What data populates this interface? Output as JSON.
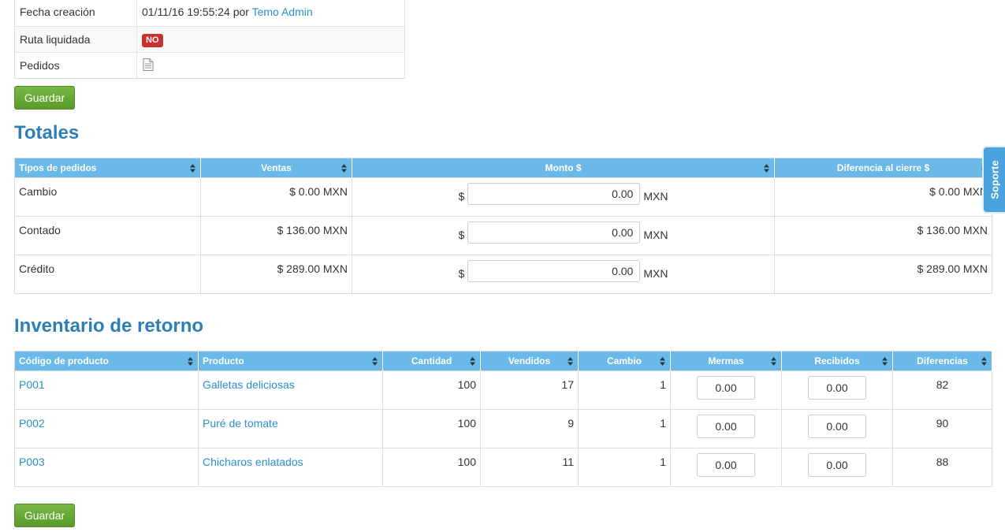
{
  "info": {
    "rows": [
      {
        "label": "Fecha creación",
        "date": "01/11/16 19:55:24",
        "by": "por",
        "user": "Temo Admin"
      },
      {
        "label": "Ruta liquidada",
        "badge": "NO"
      },
      {
        "label": "Pedidos",
        "icon": "document-icon"
      }
    ]
  },
  "buttons": {
    "save_label": "Guardar"
  },
  "totales": {
    "title": "Totales",
    "headers": [
      "Tipos de pedidos",
      "Ventas",
      "Monto $",
      "Diferencia al cierre $"
    ],
    "currency_prefix": "$",
    "currency_suffix": "MXN",
    "rows": [
      {
        "tipo": "Cambio",
        "ventas": "$ 0.00 MXN",
        "monto": "0.00",
        "diferencia": "$ 0.00 MXN"
      },
      {
        "tipo": "Contado",
        "ventas": "$ 136.00 MXN",
        "monto": "0.00",
        "diferencia": "$ 136.00 MXN"
      },
      {
        "tipo": "Crédito",
        "ventas": "$ 289.00 MXN",
        "monto": "0.00",
        "diferencia": "$ 289.00 MXN"
      }
    ]
  },
  "inventario": {
    "title": "Inventario de retorno",
    "headers": [
      "Código de producto",
      "Producto",
      "Cantidad",
      "Vendidos",
      "Cambio",
      "Mermas",
      "Recibidos",
      "Diferencias"
    ],
    "rows": [
      {
        "codigo": "P001",
        "producto": "Galletas deliciosas",
        "cantidad": "100",
        "vendidos": "17",
        "cambio": "1",
        "mermas": "0.00",
        "recibidos": "0.00",
        "diferencias": "82"
      },
      {
        "codigo": "P002",
        "producto": "Puré de tomate",
        "cantidad": "100",
        "vendidos": "9",
        "cambio": "1",
        "mermas": "0.00",
        "recibidos": "0.00",
        "diferencias": "90"
      },
      {
        "codigo": "P003",
        "producto": "Chicharos enlatados",
        "cantidad": "100",
        "vendidos": "11",
        "cambio": "1",
        "mermas": "0.00",
        "recibidos": "0.00",
        "diferencias": "88"
      }
    ]
  },
  "soporte_label": "Soporte",
  "colors": {
    "header_bg": "#6bb9e8",
    "title": "#2e7fb5",
    "link": "#2a8fd0",
    "save_button": "#5fa030",
    "badge_no": "#c9302c",
    "soporte_tab": "#4aa3df"
  }
}
